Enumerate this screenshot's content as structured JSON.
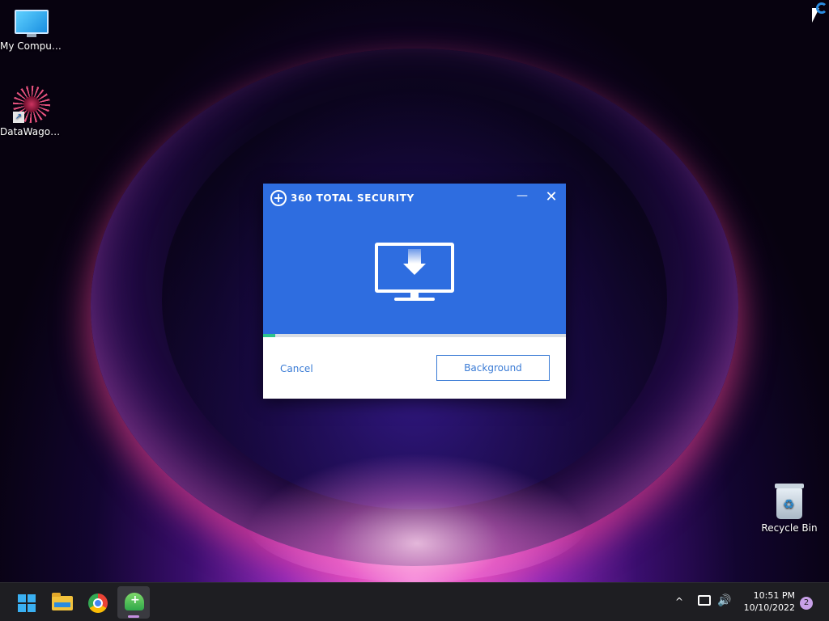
{
  "desktop": {
    "icons": [
      {
        "label": "My Computer"
      },
      {
        "label": "DataWagon..."
      },
      {
        "label": "Recycle Bin"
      }
    ]
  },
  "dialog": {
    "title": "360 TOTAL SECURITY",
    "minimize_label": "—",
    "close_label": "✕",
    "progress_percent": 4,
    "cancel_label": "Cancel",
    "background_label": "Background",
    "colors": {
      "header": "#2e6de0",
      "progress": "#2ec48c",
      "accent": "#3a7bd5"
    }
  },
  "taskbar": {
    "apps": [
      {
        "name": "start-icon"
      },
      {
        "name": "file-explorer-icon"
      },
      {
        "name": "chrome-icon"
      },
      {
        "name": "360-total-security-icon",
        "active": true
      }
    ],
    "tray": {
      "chevron": "^",
      "time": "10:51 PM",
      "date": "10/10/2022",
      "notification_count": "2"
    }
  }
}
